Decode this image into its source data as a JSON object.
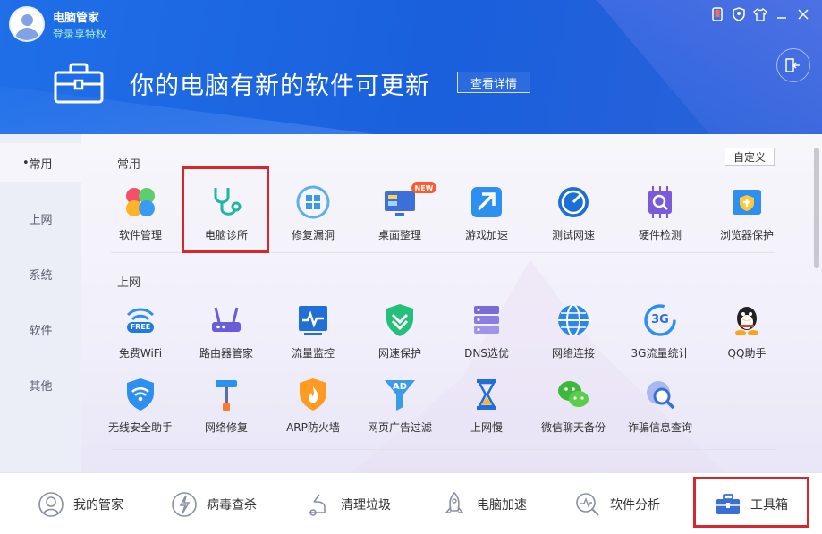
{
  "header": {
    "app_title": "电脑管家",
    "login_text": "登录享特权",
    "headline": "你的电脑有新的软件可更新",
    "detail_button": "查看详情",
    "window_controls": [
      "phone-icon",
      "shield-icon",
      "shirt-icon",
      "minimize-icon",
      "close-icon"
    ]
  },
  "sidebar": {
    "items": [
      {
        "label": "常用",
        "active": true
      },
      {
        "label": "上网",
        "active": false
      },
      {
        "label": "系统",
        "active": false
      },
      {
        "label": "软件",
        "active": false
      },
      {
        "label": "其他",
        "active": false
      }
    ]
  },
  "content": {
    "customize_button": "自定义",
    "sections": [
      {
        "title": "常用",
        "tools": [
          {
            "label": "软件管理",
            "icon": "software-manager-icon"
          },
          {
            "label": "电脑诊所",
            "icon": "stethoscope-icon",
            "highlighted": true
          },
          {
            "label": "修复漏洞",
            "icon": "repair-vulnerability-icon"
          },
          {
            "label": "桌面整理",
            "icon": "desktop-organizer-icon",
            "badge": "NEW"
          },
          {
            "label": "游戏加速",
            "icon": "game-boost-icon"
          },
          {
            "label": "测试网速",
            "icon": "speed-test-icon"
          },
          {
            "label": "硬件检测",
            "icon": "hardware-check-icon"
          },
          {
            "label": "浏览器保护",
            "icon": "browser-protection-icon"
          }
        ]
      },
      {
        "title": "上网",
        "tools": [
          {
            "label": "免费WiFi",
            "icon": "free-wifi-icon",
            "badge": "FREE"
          },
          {
            "label": "路由器管家",
            "icon": "router-icon"
          },
          {
            "label": "流量监控",
            "icon": "traffic-monitor-icon"
          },
          {
            "label": "网速保护",
            "icon": "speed-protection-icon"
          },
          {
            "label": "DNS选优",
            "icon": "dns-icon"
          },
          {
            "label": "网络连接",
            "icon": "globe-icon"
          },
          {
            "label": "3G流量统计",
            "icon": "3g-icon",
            "badge": "3G"
          },
          {
            "label": "QQ助手",
            "icon": "qq-penguin-icon"
          },
          {
            "label": "无线安全助手",
            "icon": "wifi-shield-icon"
          },
          {
            "label": "网络修复",
            "icon": "network-repair-icon"
          },
          {
            "label": "ARP防火墙",
            "icon": "firewall-icon"
          },
          {
            "label": "网页广告过滤",
            "icon": "ad-filter-icon",
            "badge": "AD"
          },
          {
            "label": "上网慢",
            "icon": "hourglass-icon"
          },
          {
            "label": "微信聊天备份",
            "icon": "wechat-icon"
          },
          {
            "label": "诈骗信息查询",
            "icon": "fraud-query-icon"
          }
        ]
      }
    ]
  },
  "bottom_nav": [
    {
      "label": "我的管家",
      "icon": "butler-icon"
    },
    {
      "label": "病毒查杀",
      "icon": "virus-scan-icon"
    },
    {
      "label": "清理垃圾",
      "icon": "vacuum-icon"
    },
    {
      "label": "电脑加速",
      "icon": "rocket-icon"
    },
    {
      "label": "软件分析",
      "icon": "analysis-icon"
    },
    {
      "label": "工具箱",
      "icon": "toolbox-icon",
      "active": true
    }
  ],
  "colors": {
    "header_blue": "#1f6fe8",
    "highlight_red": "#d9262c",
    "accent_green": "#a7f0d0"
  }
}
